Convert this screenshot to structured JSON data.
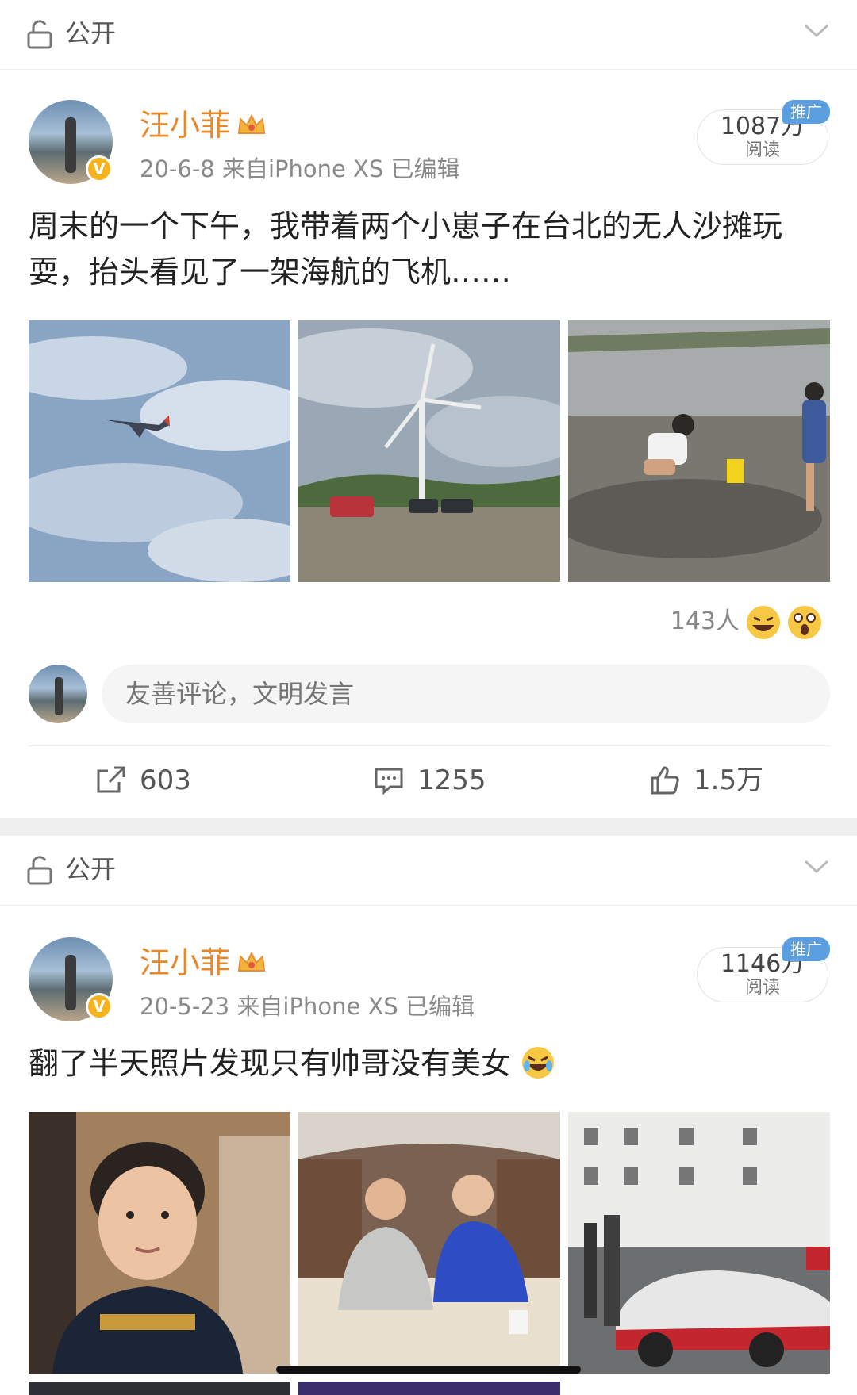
{
  "privacy_bars": [
    {
      "label": "公开"
    },
    {
      "label": "公开"
    }
  ],
  "posts": [
    {
      "username": "汪小菲",
      "meta": "20-6-8  来自iPhone XS  已编辑",
      "reads": "1087万",
      "reads_label": "阅读",
      "promo_badge": "推广",
      "text": "周末的一个下午，我带着两个小崽子在台北的无人沙摊玩耍，抬头看见了一架海航的飞机……",
      "photos": [
        "airplane-in-sky-photo",
        "wind-turbine-beach-photo",
        "child-digging-sand-photo"
      ],
      "reactions_count": "143人",
      "reaction_icons": [
        "laughing-emoji-icon",
        "shocked-emoji-icon"
      ],
      "comment_placeholder": "友善评论，文明发言",
      "actions": {
        "share": "603",
        "comment": "1255",
        "like": "1.5万"
      }
    },
    {
      "username": "汪小菲",
      "meta": "20-5-23  来自iPhone XS  已编辑",
      "reads": "1146万",
      "reads_label": "阅读",
      "promo_badge": "推广",
      "text": "翻了半天照片发现只有帅哥没有美女",
      "text_emoji": "crying-laughing-emoji-icon",
      "photos": [
        "boy-portrait-photo",
        "two-men-in-jet-photo",
        "racing-car-building-photo"
      ]
    }
  ],
  "colors": {
    "username": "#e8872a",
    "promo": "#5b9fe0",
    "verified": "#f6b31c"
  }
}
